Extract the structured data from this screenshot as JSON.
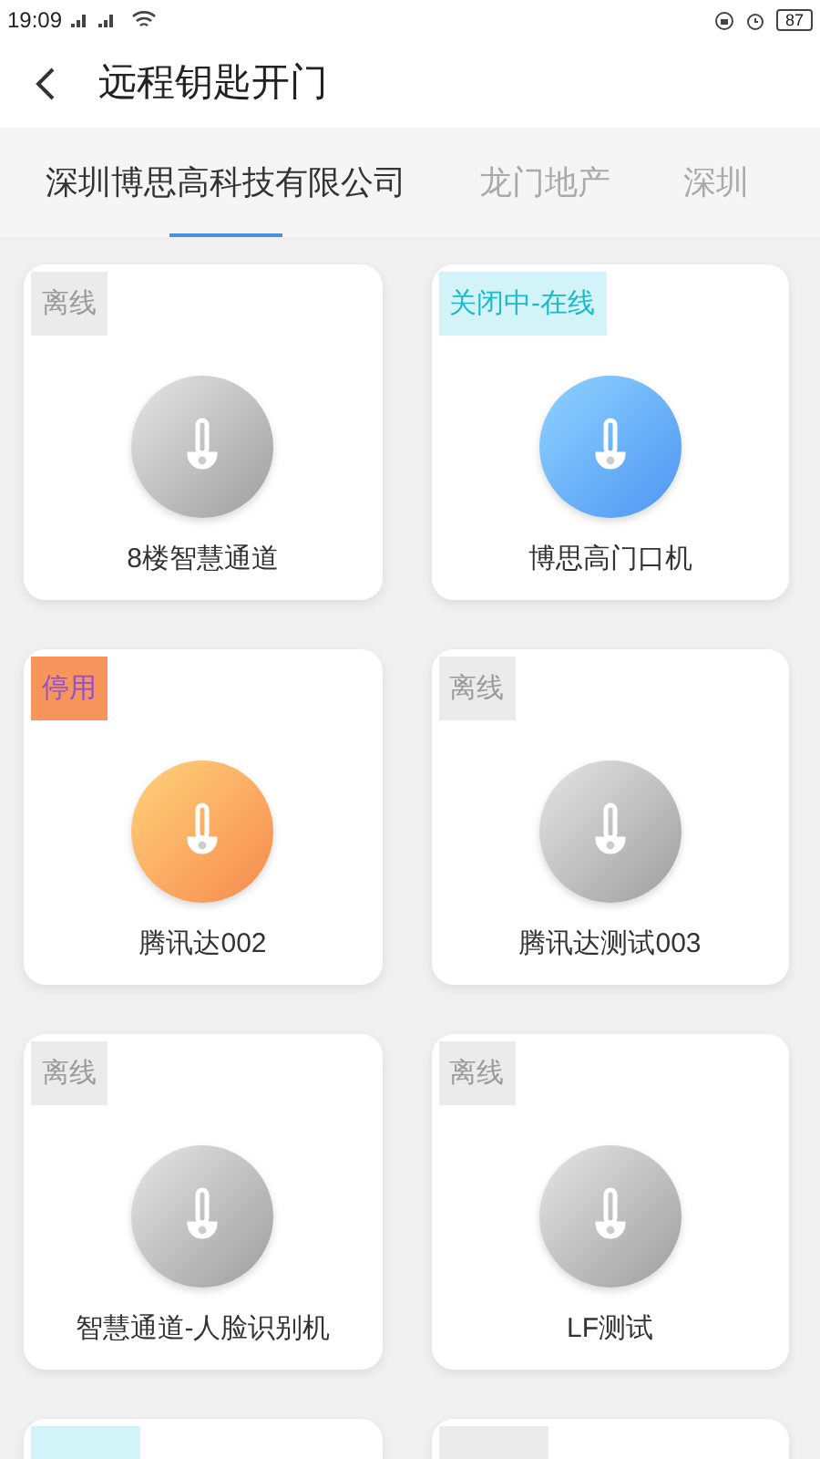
{
  "status_bar": {
    "time": "19:09",
    "battery": "87"
  },
  "header": {
    "title": "远程钥匙开门"
  },
  "tabs": [
    {
      "label": "深圳博思高科技有限公司",
      "selected": true
    },
    {
      "label": "龙门地产",
      "selected": false
    },
    {
      "label": "深圳",
      "selected": false
    }
  ],
  "devices": [
    {
      "kind": "offline",
      "status": "离线",
      "name": "8楼智慧通道"
    },
    {
      "kind": "online",
      "status": "关闭中-在线",
      "name": "博思高门口机"
    },
    {
      "kind": "disabled",
      "status": "停用",
      "name": "腾讯达002"
    },
    {
      "kind": "offline",
      "status": "离线",
      "name": "腾讯达测试003"
    },
    {
      "kind": "offline",
      "status": "离线",
      "name": "智慧通道-人脸识别机"
    },
    {
      "kind": "offline",
      "status": "离线",
      "name": "LF测试"
    },
    {
      "kind": "online"
    },
    {
      "kind": "offline"
    }
  ]
}
